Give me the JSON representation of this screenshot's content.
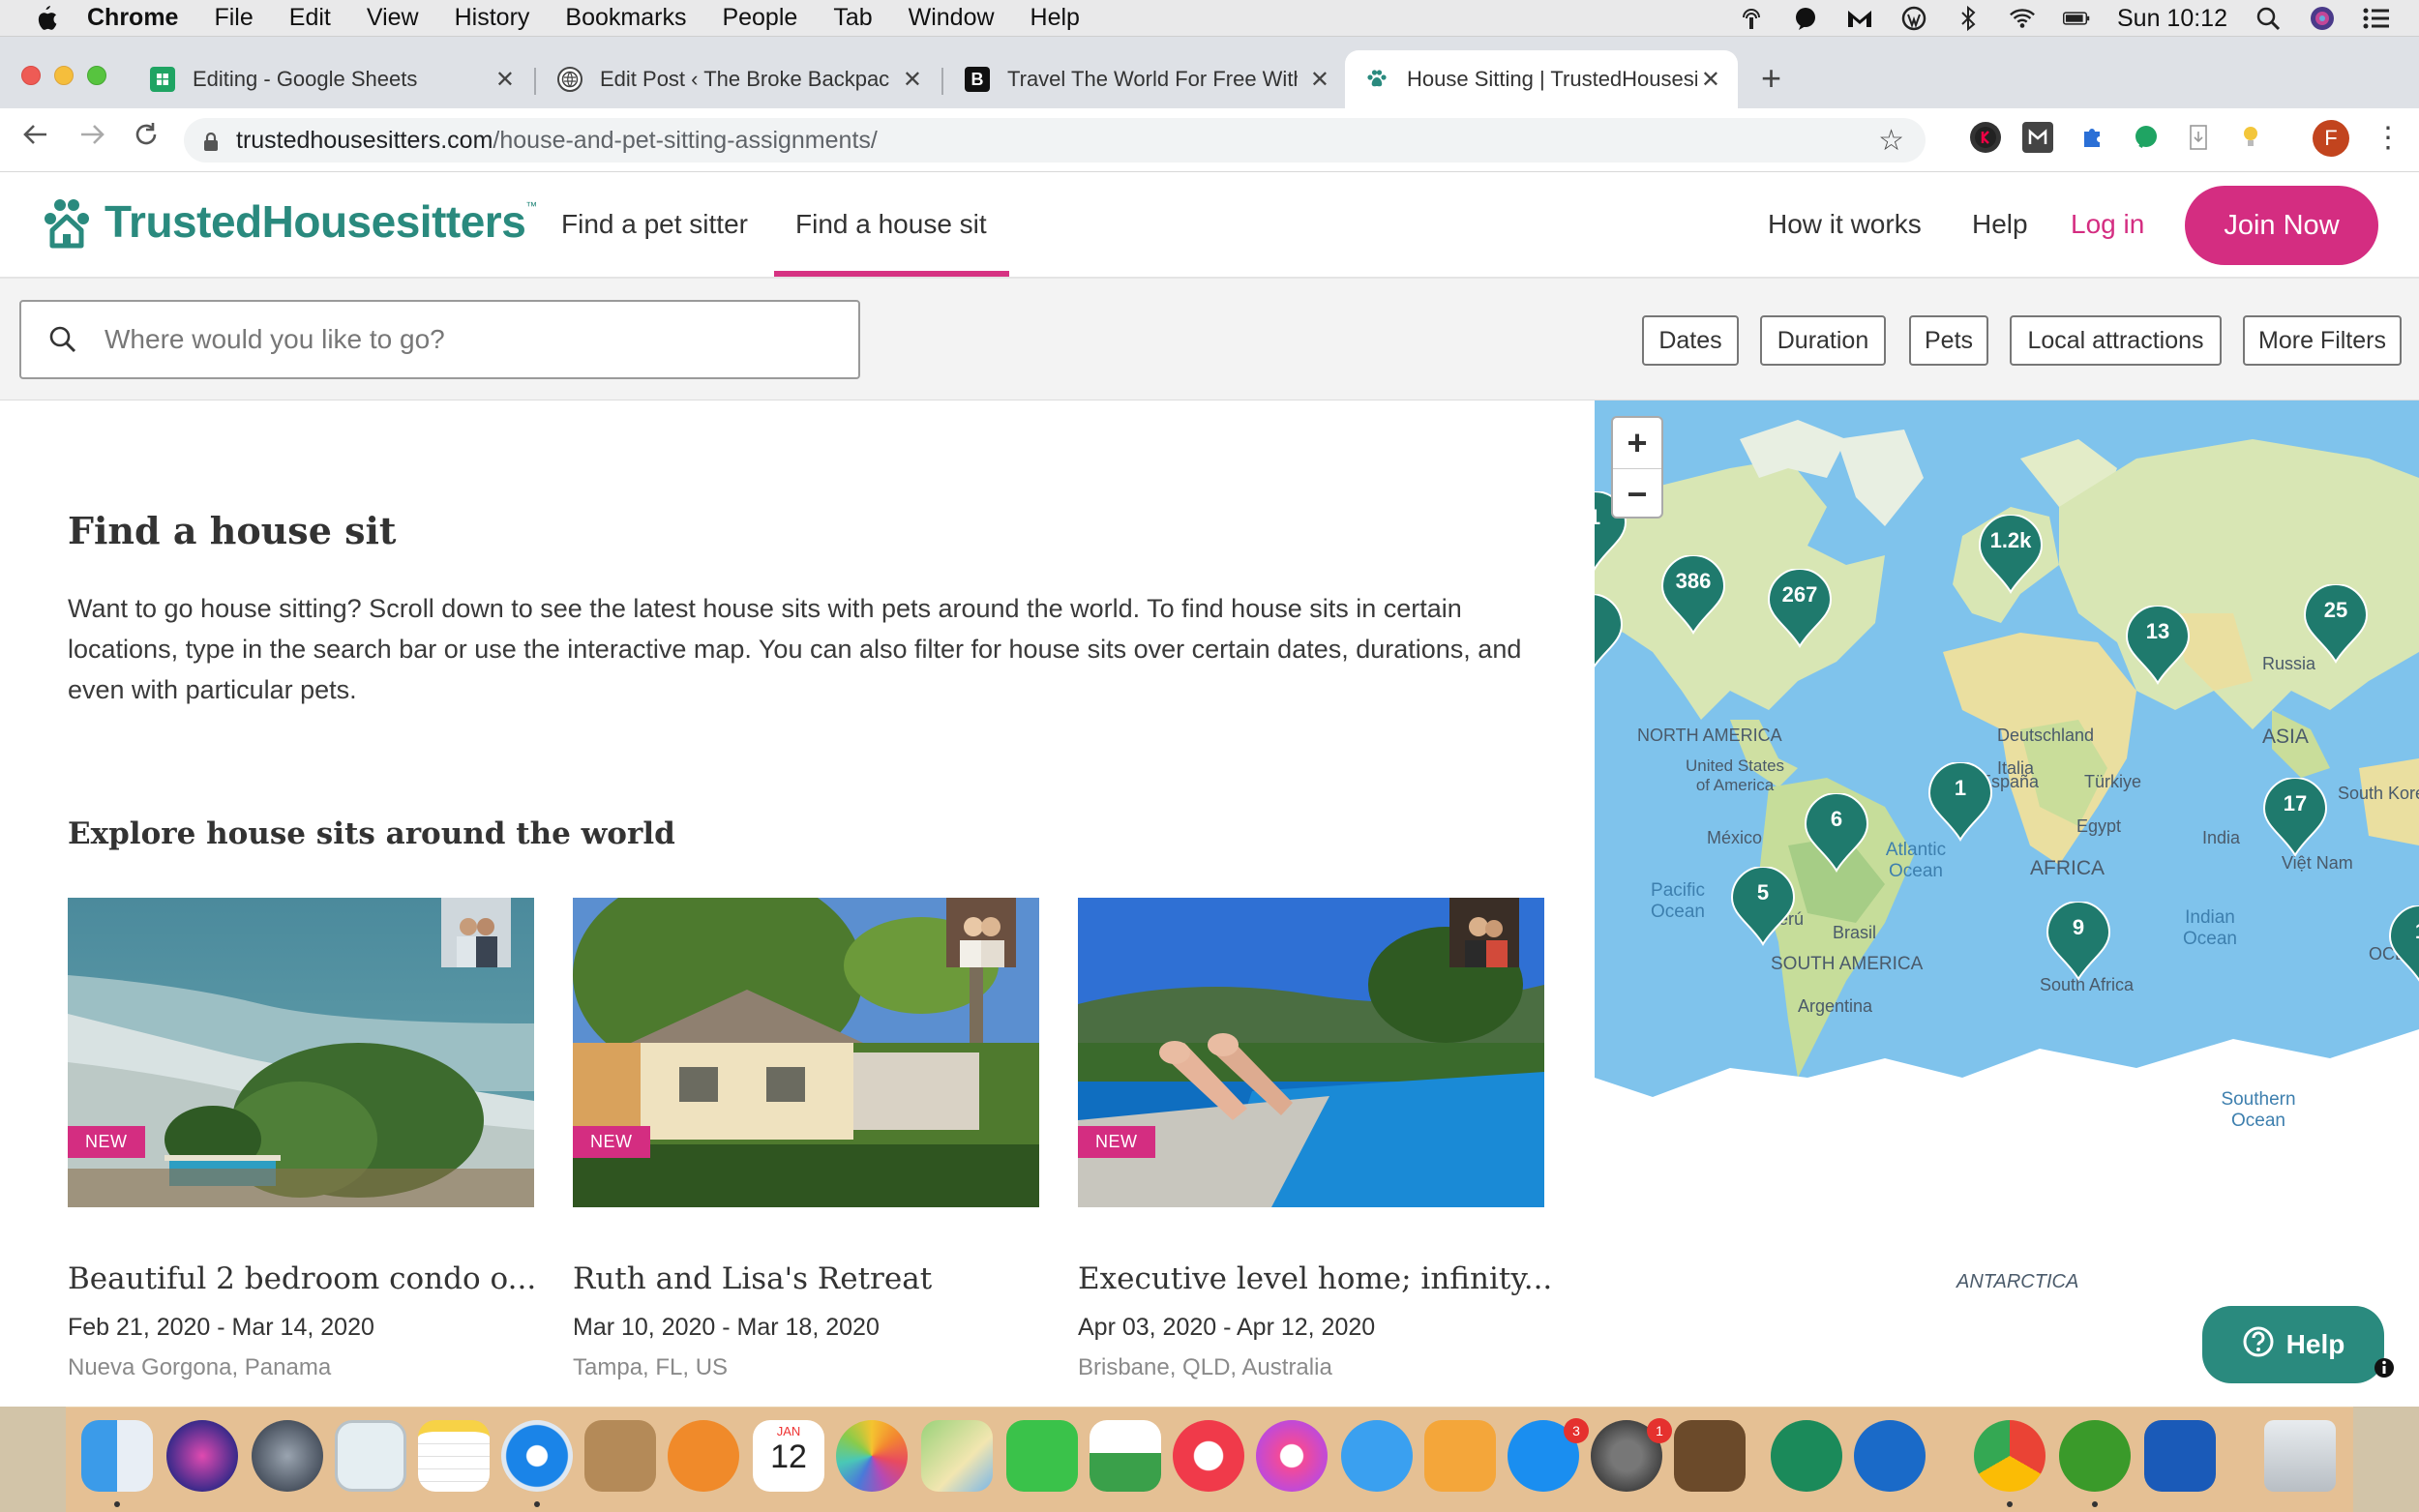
{
  "menubar": {
    "app": "Chrome",
    "items": [
      "File",
      "Edit",
      "View",
      "History",
      "Bookmarks",
      "People",
      "Tab",
      "Window",
      "Help"
    ],
    "clock": "Sun 10:12"
  },
  "tabs": [
    {
      "title": "Editing - Google Sheets",
      "icon": "sheets-icon"
    },
    {
      "title": "Edit Post ‹ The Broke Backpacker",
      "icon": "wordpress-icon"
    },
    {
      "title": "Travel The World For Free With",
      "icon": "broke-backpacker-icon"
    },
    {
      "title": "House Sitting | TrustedHousesitters",
      "icon": "paw-icon"
    }
  ],
  "address": {
    "host": "trustedhousesitters.com",
    "path": "/house-and-pet-sitting-assignments/"
  },
  "profile_initial": "F",
  "site": {
    "logo": "TrustedHousesitters",
    "logo_tm": "™",
    "nav": {
      "pet_sitter": "Find a pet sitter",
      "house_sit": "Find a house sit",
      "how_it_works": "How it works",
      "help": "Help",
      "login": "Log in",
      "join": "Join Now"
    },
    "brand_color": "#2a8a7e",
    "accent_color": "#d42d81"
  },
  "search": {
    "placeholder": "Where would you like to go?",
    "value": ""
  },
  "filters": [
    "Dates",
    "Duration",
    "Pets",
    "Local attractions",
    "More Filters"
  ],
  "page": {
    "title": "Find a house sit",
    "intro": "Want to go house sitting? Scroll down to see the latest house sits with pets around the world. To find house sits in certain locations, type in the search bar or use the interactive map. You can also filter for house sits over certain dates, durations, and even with particular pets.",
    "explore_heading": "Explore house sits around the world"
  },
  "listings": [
    {
      "badge": "NEW",
      "title": "Beautiful 2 bedroom condo o...",
      "dates": "Feb 21, 2020 - Mar 14, 2020",
      "location": "Nueva Gorgona, Panama"
    },
    {
      "badge": "NEW",
      "title": "Ruth and Lisa's Retreat",
      "dates": "Mar 10, 2020 - Mar 18, 2020",
      "location": "Tampa, FL, US"
    },
    {
      "badge": "NEW",
      "title": "Executive level home; infinity...",
      "dates": "Apr 03, 2020 - Apr 12, 2020",
      "location": "Brisbane, QLD, Australia"
    }
  ],
  "map": {
    "zoom_in": "+",
    "zoom_out": "−",
    "labels": {
      "russia": "Russia",
      "asia": "ASIA",
      "north_america": "NORTH AMERICA",
      "united_states": "United States of America",
      "mexico": "México",
      "deutschland": "Deutschland",
      "italia": "Italia",
      "espana": "España",
      "turkiye": "Türkiye",
      "egypt": "Egypt",
      "africa": "AFRICA",
      "india": "India",
      "viet_nam": "Việt Nam",
      "south_korea": "South Korea",
      "peru": "Perú",
      "brasil": "Brasil",
      "south_america": "SOUTH AMERICA",
      "argentina": "Argentina",
      "south_africa": "South Africa",
      "antarctica": "ANTARCTICA",
      "atlantic": "Atlantic Ocean",
      "pacific": "Pacific Ocean",
      "indian": "Indian Ocean",
      "southern": "Southern Ocean",
      "oceania": "OCEANIA"
    },
    "clusters": {
      "far_left": "1",
      "canada_west": "386",
      "canada_east": "267",
      "europe": "1.2k",
      "middle_east": "13",
      "asia_east": "25",
      "atlantic": "1",
      "asia_se": "17",
      "caribbean": "6",
      "south_america": "5",
      "africa": "9",
      "oceania": "1"
    }
  },
  "help_button": "Help",
  "dock": {
    "calendar_month": "JAN",
    "calendar_day": "12",
    "appstore_badge": "3",
    "settings_badge": "1"
  }
}
